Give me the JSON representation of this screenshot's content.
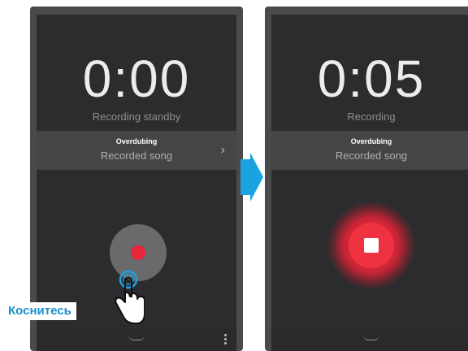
{
  "left_screen": {
    "timer": "0:00",
    "status": "Recording standby",
    "bar_title": "Overdubing",
    "bar_song": "Recorded song",
    "chevron": "›"
  },
  "right_screen": {
    "timer": "0:05",
    "status": "Recording",
    "bar_title": "Overdubing",
    "bar_song": "Recorded song"
  },
  "tap_label": "Коснитесь",
  "colors": {
    "record_red": "#e8253a",
    "arrow_blue": "#1aa3e0",
    "label_blue": "#1a8fd0"
  }
}
